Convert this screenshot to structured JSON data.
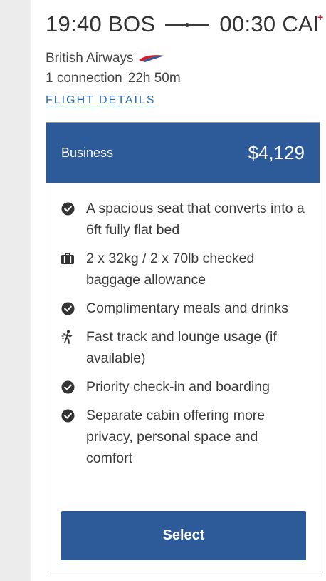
{
  "flight": {
    "departure": "19:40 BOS",
    "arrival": "00:30 CAI",
    "day_offset_marker": "+",
    "airline": "British Airways",
    "connections": "1 connection",
    "duration": "22h 50m",
    "details_link": "FLIGHT DETAILS"
  },
  "fare": {
    "cabin": "Business",
    "price": "$4,129",
    "features": [
      {
        "icon": "check-circle-icon",
        "text": "A spacious seat that converts into a 6ft fully flat bed"
      },
      {
        "icon": "suitcase-icon",
        "text": "2 x 32kg / 2 x 70lb checked baggage allowance"
      },
      {
        "icon": "check-circle-icon",
        "text": "Complimentary meals and drinks"
      },
      {
        "icon": "fast-track-walker-icon",
        "text": "Fast track and lounge usage (if available)"
      },
      {
        "icon": "check-circle-icon",
        "text": "Priority check-in and boarding"
      },
      {
        "icon": "check-circle-icon",
        "text": "Separate cabin offering more privacy, personal space and comfort"
      }
    ],
    "select_label": "Select"
  },
  "colors": {
    "header_blue": "#2d5b9a",
    "link_blue": "#2b6aad",
    "plus_red": "#d61d2a",
    "gutter_gray": "#ececec"
  }
}
